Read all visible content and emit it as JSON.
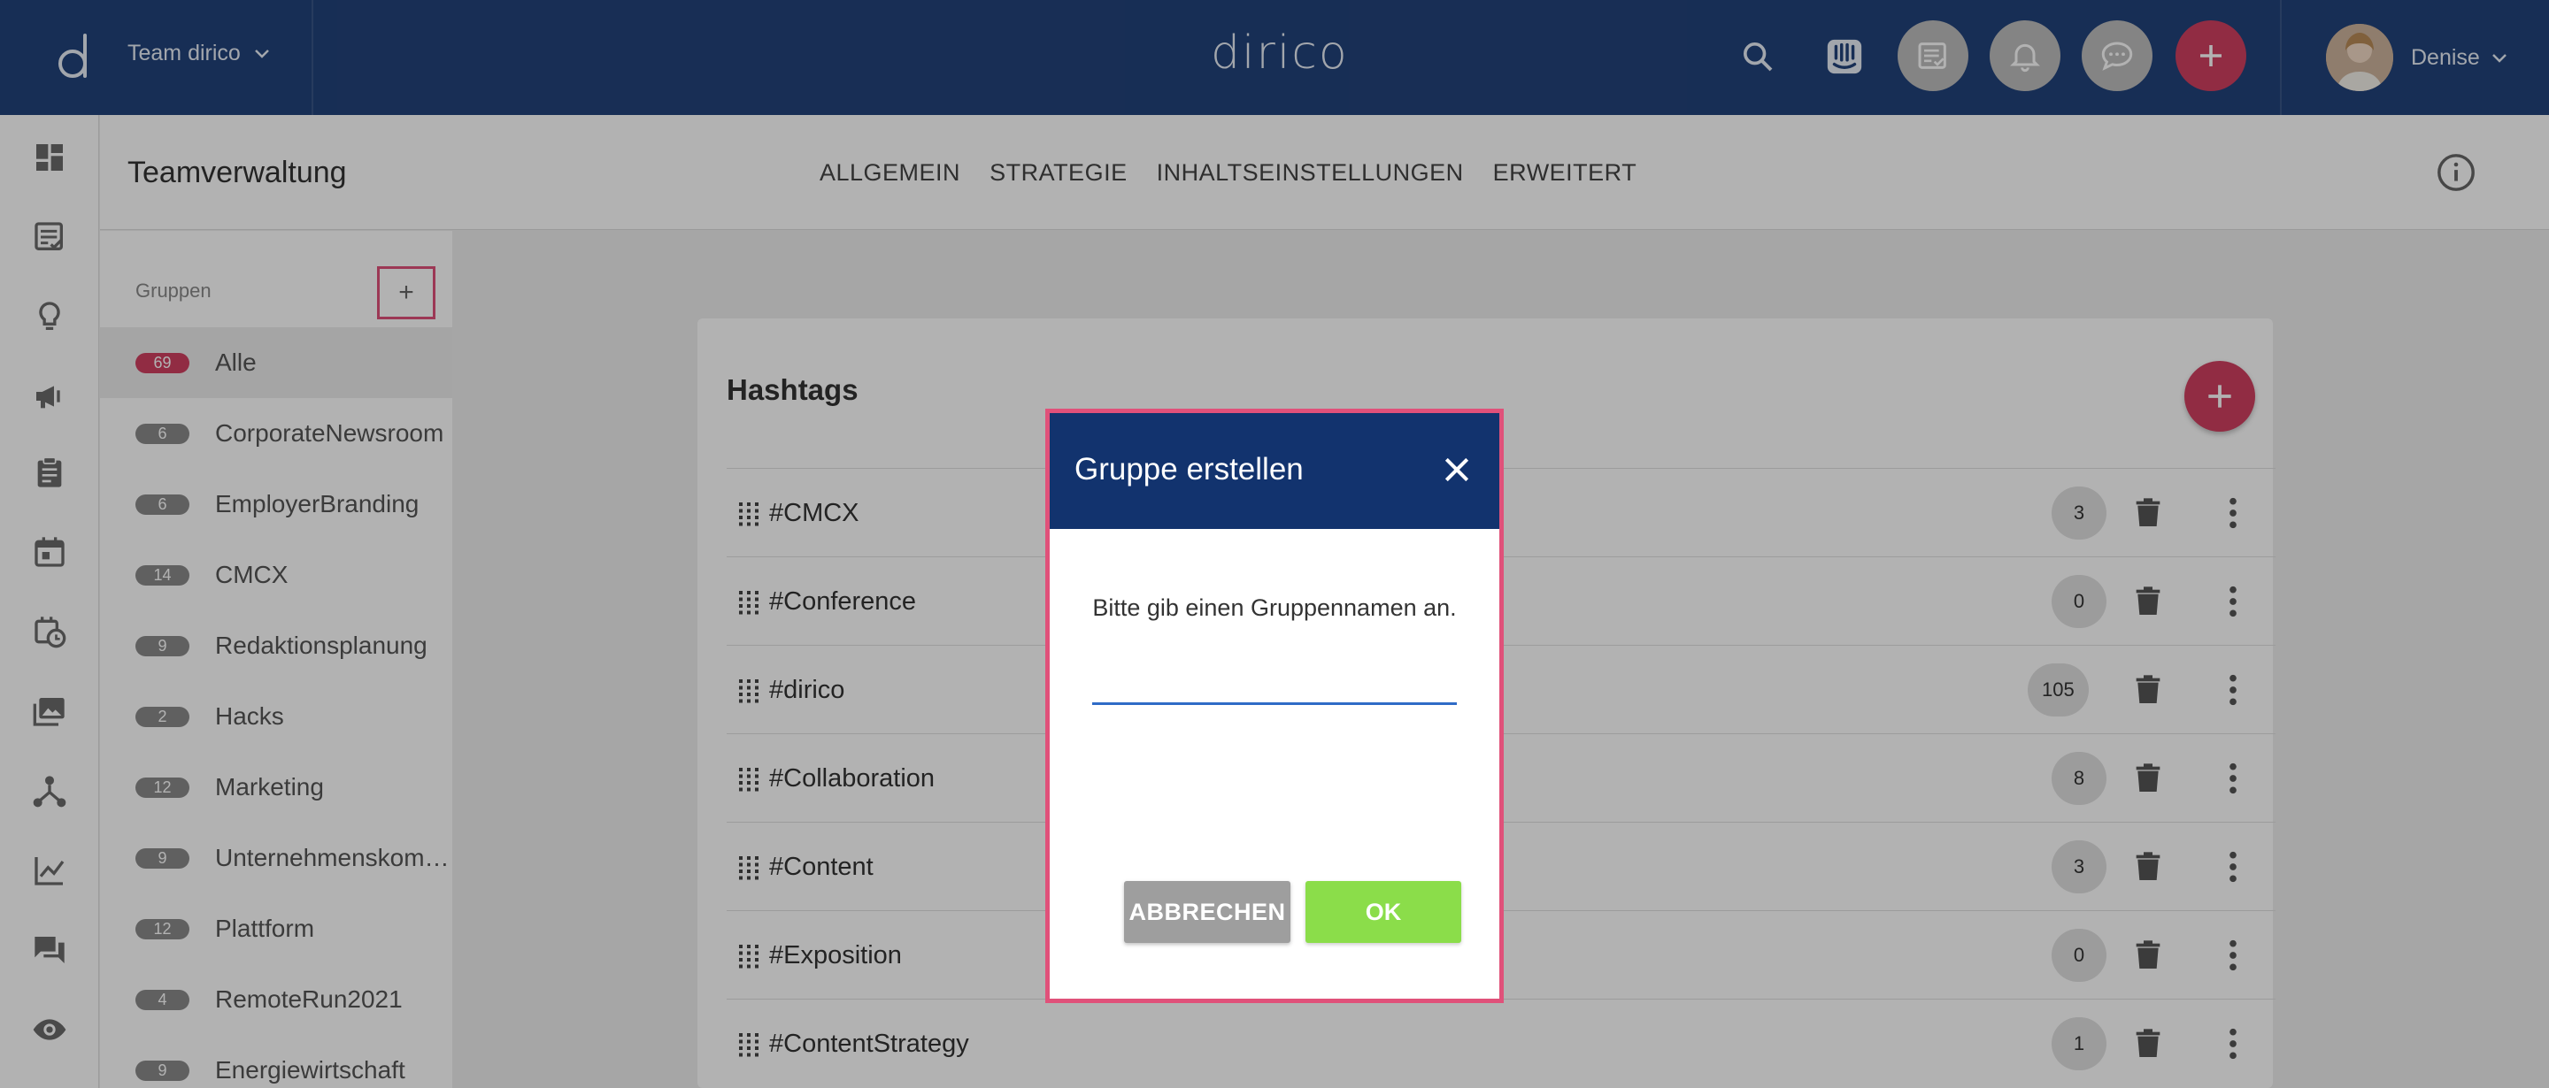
{
  "topbar": {
    "team_label": "Team dirico",
    "brand": "dirico",
    "user_name": "Denise",
    "icons": [
      "search-icon",
      "intercom-icon",
      "tasks-icon",
      "bell-icon",
      "chat-icon",
      "add-icon"
    ]
  },
  "rail": {
    "icons": [
      "dashboard-icon",
      "posts-icon",
      "ideas-icon",
      "campaigns-icon",
      "briefings-icon",
      "calendar-icon",
      "schedule-icon",
      "media-icon",
      "workflow-icon",
      "analytics-icon",
      "comments-icon",
      "monitoring-icon"
    ]
  },
  "header": {
    "title": "Teamverwaltung",
    "tabs": [
      "ALLGEMEIN",
      "STRATEGIE",
      "INHALTSEINSTELLUNGEN",
      "ERWEITERT"
    ]
  },
  "groups": {
    "label": "Gruppen",
    "add_symbol": "+",
    "items": [
      {
        "count": "69",
        "name": "Alle"
      },
      {
        "count": "6",
        "name": "CorporateNewsroom"
      },
      {
        "count": "6",
        "name": "EmployerBranding"
      },
      {
        "count": "14",
        "name": "CMCX"
      },
      {
        "count": "9",
        "name": "Redaktionsplanung"
      },
      {
        "count": "2",
        "name": "Hacks"
      },
      {
        "count": "12",
        "name": "Marketing"
      },
      {
        "count": "9",
        "name": "Unternehmenskom…"
      },
      {
        "count": "12",
        "name": "Plattform"
      },
      {
        "count": "4",
        "name": "RemoteRun2021"
      },
      {
        "count": "9",
        "name": "Energiewirtschaft"
      }
    ]
  },
  "hashtags": {
    "title": "Hashtags",
    "rows": [
      {
        "name": "#CMCX",
        "count": "3"
      },
      {
        "name": "#Conference",
        "count": "0"
      },
      {
        "name": "#dirico",
        "count": "105"
      },
      {
        "name": "#Collaboration",
        "count": "8"
      },
      {
        "name": "#Content",
        "count": "3"
      },
      {
        "name": "#Exposition",
        "count": "0"
      },
      {
        "name": "#ContentStrategy",
        "count": "1"
      }
    ]
  },
  "dialog": {
    "title": "Gruppe erstellen",
    "message": "Bitte gib einen Gruppennamen an.",
    "input_value": "",
    "cancel_label": "ABBRECHEN",
    "ok_label": "OK"
  },
  "colors": {
    "topbar": "#22427a",
    "dialog_header": "#12336e",
    "accent_red": "#d04060",
    "ok_green": "#8bdd4a",
    "highlight_border": "#e0517a"
  }
}
